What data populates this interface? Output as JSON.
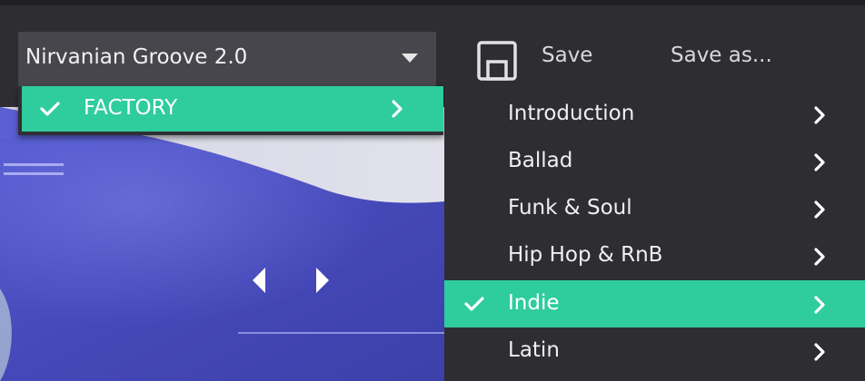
{
  "preset": {
    "name": "Nirvanian Groove 2.0"
  },
  "toolbar": {
    "save_label": "Save",
    "save_as_label": "Save as...",
    "save_icon": "floppy-disk-icon"
  },
  "menu_level1": {
    "items": [
      {
        "label": "FACTORY",
        "selected": true,
        "has_submenu": true
      }
    ]
  },
  "menu_level2": {
    "items": [
      {
        "label": "Introduction",
        "selected": false,
        "has_submenu": true
      },
      {
        "label": "Ballad",
        "selected": false,
        "has_submenu": true
      },
      {
        "label": "Funk & Soul",
        "selected": false,
        "has_submenu": true
      },
      {
        "label": "Hip Hop & RnB",
        "selected": false,
        "has_submenu": true
      },
      {
        "label": "Indie",
        "selected": true,
        "has_submenu": true
      },
      {
        "label": "Latin",
        "selected": false,
        "has_submenu": true
      }
    ]
  },
  "colors": {
    "accent": "#2fcc9d",
    "panel": "#2d2d32",
    "selector": "#46464c",
    "artwork_blue": "#4a4fc0"
  }
}
